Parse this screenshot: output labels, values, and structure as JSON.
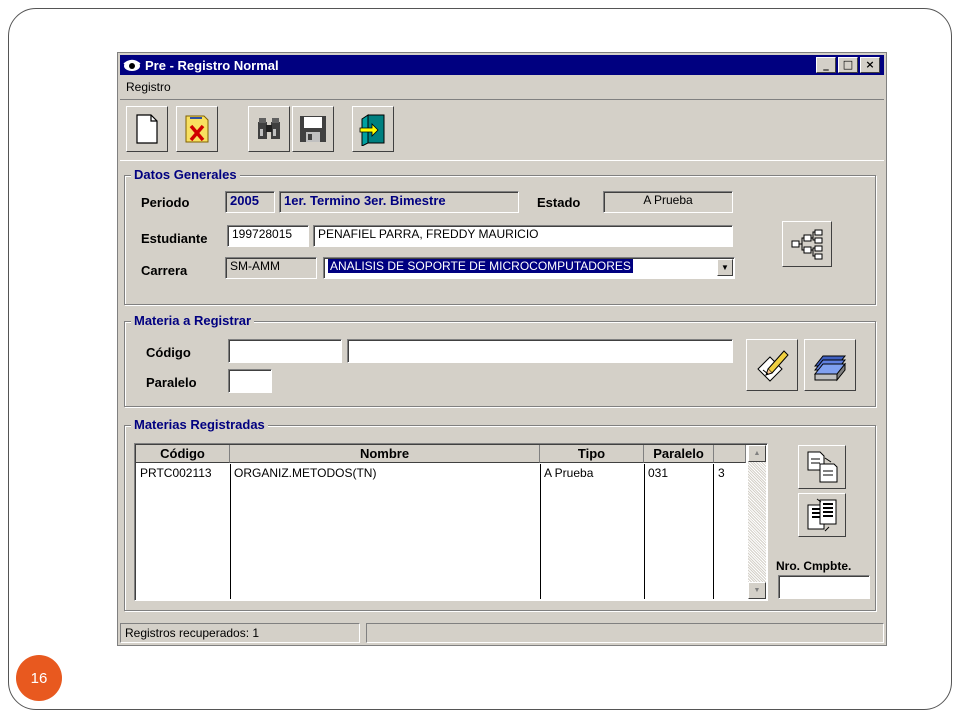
{
  "slide": {
    "page_number": "16"
  },
  "window": {
    "title": "Pre - Registro Normal",
    "buttons": {
      "minimize": "_",
      "maximize": "□",
      "close": "×"
    }
  },
  "menu": {
    "items": [
      "Registro"
    ]
  },
  "toolbar": {
    "buttons": [
      "new-document-icon",
      "cancel-icon",
      "search-binoculars-icon",
      "save-disk-icon",
      "exit-door-icon"
    ]
  },
  "datos_generales": {
    "title": "Datos Generales",
    "periodo_label": "Periodo",
    "periodo_year": "2005",
    "periodo_desc": "1er. Termino 3er. Bimestre",
    "estado_label": "Estado",
    "estado_value": "A Prueba",
    "estudiante_label": "Estudiante",
    "estudiante_id": "199728015",
    "estudiante_nombre": "PENAFIEL PARRA, FREDDY MAURICIO",
    "carrera_label": "Carrera",
    "carrera_code": "SM-AMM",
    "carrera_nombre": "ANALISIS DE SOPORTE DE MICROCOMPUTADORES"
  },
  "materia_registrar": {
    "title": "Materia a Registrar",
    "codigo_label": "Código",
    "codigo_value": "",
    "nombre_value": "",
    "paralelo_label": "Paralelo",
    "paralelo_value": ""
  },
  "materias_registradas": {
    "title": "Materias Registradas",
    "columns": [
      "Código",
      "Nombre",
      "Tipo",
      "Paralelo",
      ""
    ],
    "rows": [
      [
        "PRTC002113",
        "ORGANIZ.METODOS(TN)",
        "A Prueba",
        "031",
        "3"
      ]
    ],
    "comprobante_label": "Nro. Cmpbte.",
    "comprobante_value": ""
  },
  "status": {
    "message": "Registros recuperados:  1",
    "second_panel": ""
  },
  "colors": {
    "title_bar": "#000080",
    "window_bg": "#d4d0c8",
    "page_badge": "#e8591f"
  }
}
